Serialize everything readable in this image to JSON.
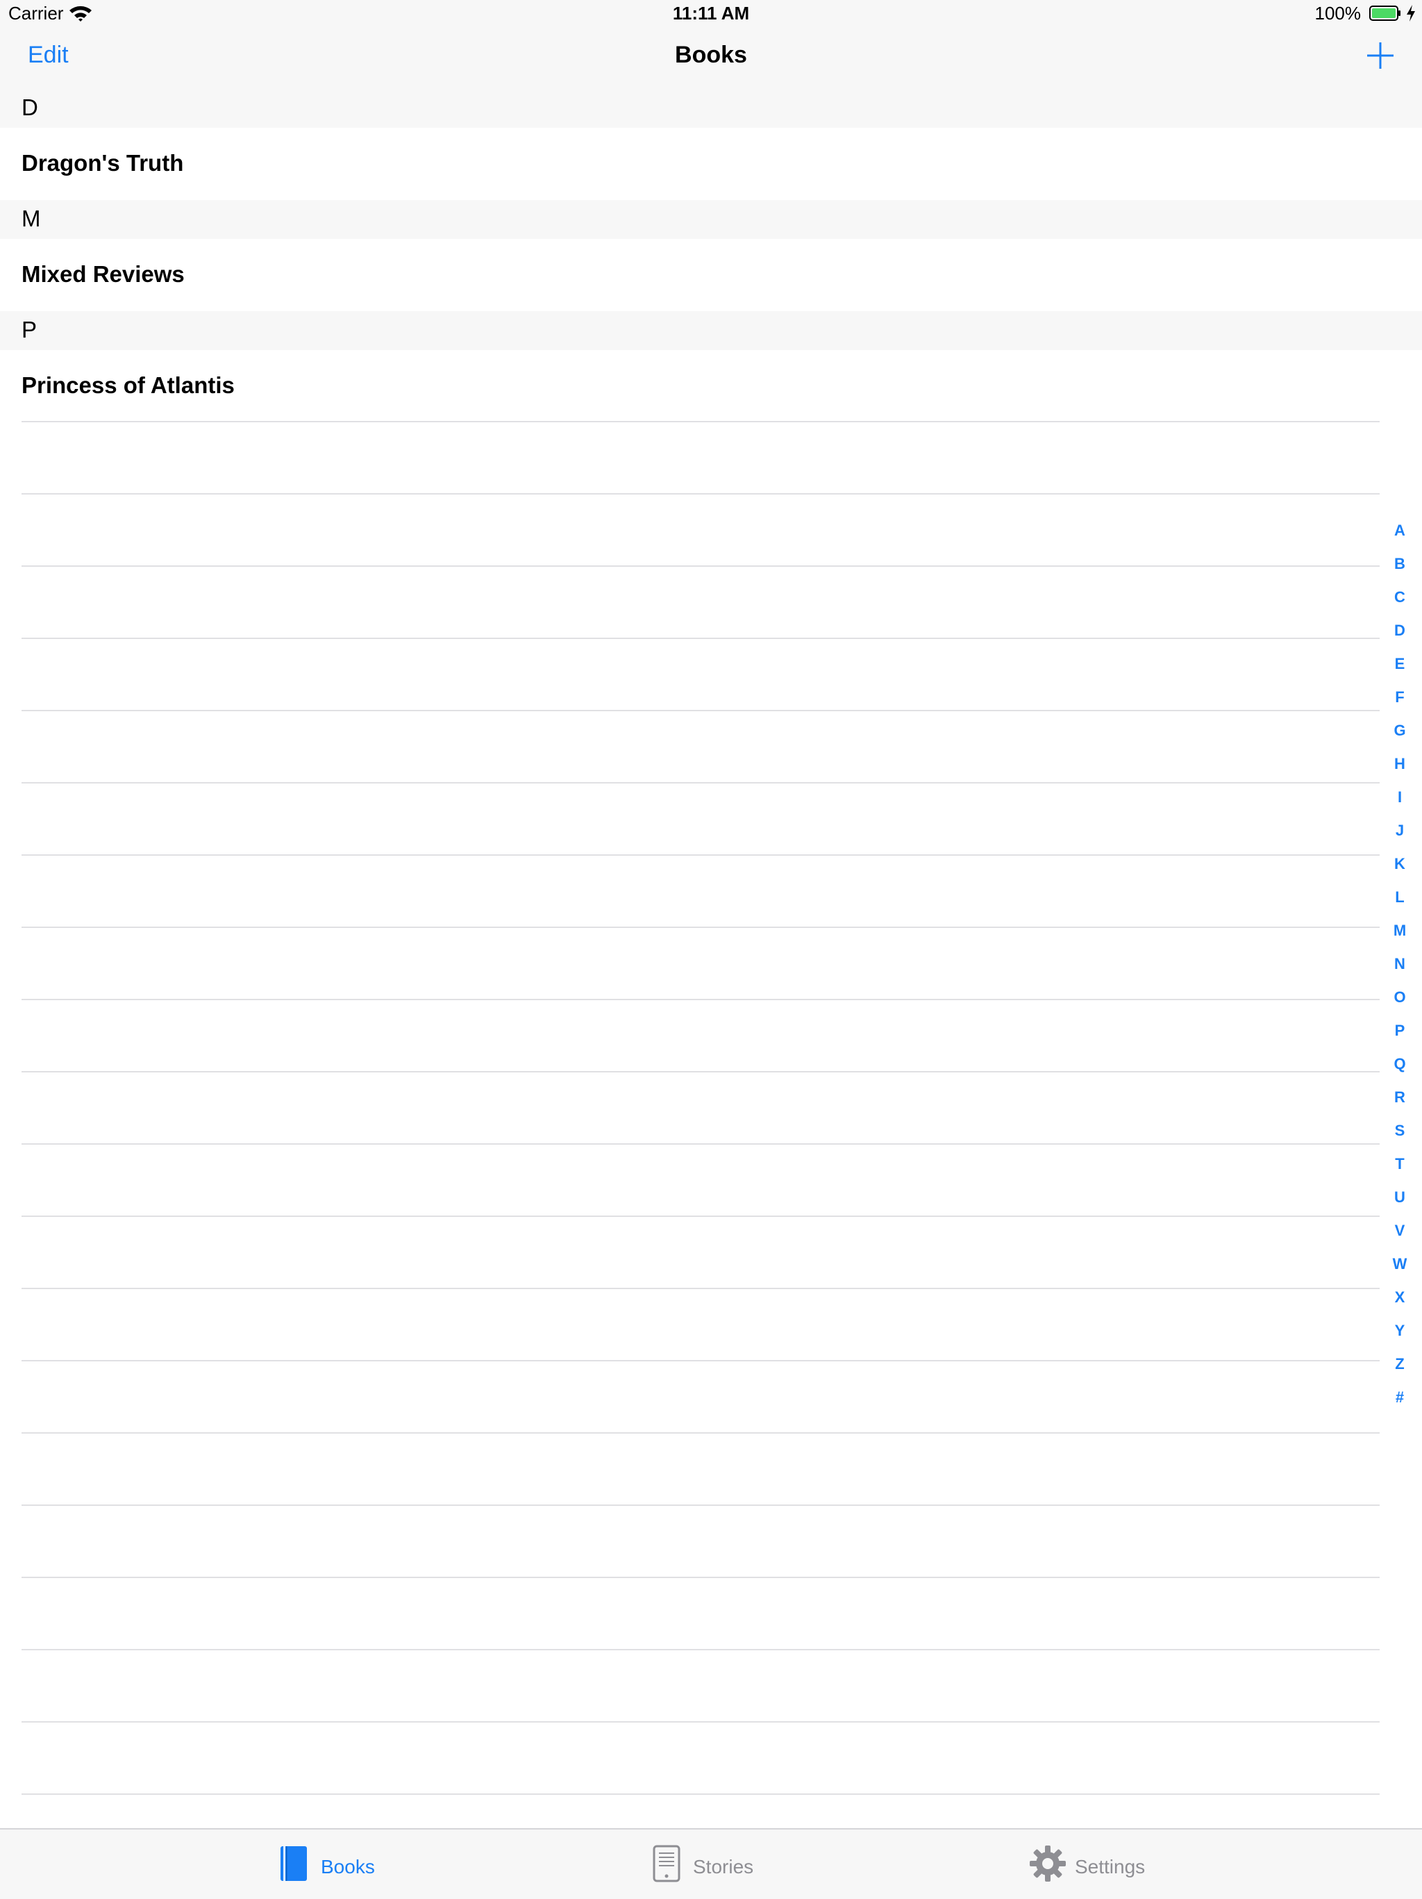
{
  "status": {
    "carrier": "Carrier",
    "time": "11:11 AM",
    "battery": "100%"
  },
  "nav": {
    "edit_label": "Edit",
    "title": "Books",
    "add_icon": "plus-icon"
  },
  "sections": [
    {
      "letter": "D",
      "items": [
        "Dragon's Truth"
      ]
    },
    {
      "letter": "M",
      "items": [
        "Mixed Reviews"
      ]
    },
    {
      "letter": "P",
      "items": [
        "Princess of Atlantis"
      ]
    }
  ],
  "index": [
    "A",
    "B",
    "C",
    "D",
    "E",
    "F",
    "G",
    "H",
    "I",
    "J",
    "K",
    "L",
    "M",
    "N",
    "O",
    "P",
    "Q",
    "R",
    "S",
    "T",
    "U",
    "V",
    "W",
    "X",
    "Y",
    "Z",
    "#"
  ],
  "tabs": [
    {
      "label": "Books",
      "icon": "book-icon",
      "selected": true
    },
    {
      "label": "Stories",
      "icon": "tablet-icon",
      "selected": false
    },
    {
      "label": "Settings",
      "icon": "gear-icon",
      "selected": false
    }
  ],
  "colors": {
    "accent": "#1a7ff5",
    "inactive": "#8e8e93",
    "battery": "#4cd964"
  }
}
